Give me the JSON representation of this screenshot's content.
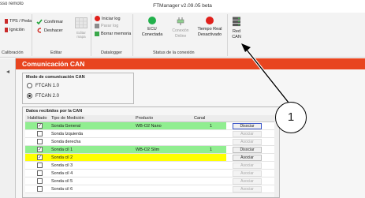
{
  "window": {
    "title": "FTManager v2.09.05 beta",
    "app_label": "sso remoto"
  },
  "ribbon": {
    "group1": {
      "items": [
        "TPS / Pedal",
        "Ignición"
      ],
      "label": "Calibración"
    },
    "group2": {
      "confirm": "Confirmar",
      "undo": "Deshacer",
      "edit_map": "Editar\nmapa",
      "label": "Editar"
    },
    "group3": {
      "items": [
        "Iniciar log",
        "Parar log",
        "Borrar memoria"
      ],
      "label": "Datalogger"
    },
    "group4": {
      "buttons": [
        {
          "label": "ECU\nConectada",
          "color": "#22b14c"
        },
        {
          "label": "Conexión\nOnline",
          "color": "#9a9a9a"
        },
        {
          "label": "Tiempo Real\nDesactivado",
          "color": "#e0201b"
        }
      ],
      "label": "Status de la conexión"
    },
    "group5": {
      "label": "Red\nCAN"
    }
  },
  "panel": {
    "title": "Comunicación CAN",
    "mode": {
      "legend": "Modo de comunicación CAN",
      "options": [
        {
          "label": "FTCAN 1.0",
          "selected": false
        },
        {
          "label": "FTCAN 2.0",
          "selected": true
        }
      ]
    },
    "data": {
      "legend": "Datos recibidos por la CAN",
      "columns": [
        "Habilitado",
        "Tipo de Medición",
        "Producto",
        "Canal"
      ],
      "rows": [
        {
          "checked": true,
          "type": "Sonda General",
          "product": "WB-O2 Nano",
          "channel": "1",
          "action": "Disociar",
          "highlight": "#90ee90",
          "enabled": true
        },
        {
          "checked": false,
          "type": "Sonda Izquierda",
          "product": "",
          "channel": "",
          "action": "Asociar",
          "highlight": "",
          "enabled": false
        },
        {
          "checked": false,
          "type": "Sonda derecha",
          "product": "",
          "channel": "",
          "action": "Asociar",
          "highlight": "",
          "enabled": false
        },
        {
          "checked": true,
          "type": "Sonda cil 1",
          "product": "WB-O2 Slim",
          "channel": "1",
          "action": "Disociar",
          "highlight": "#90ee90",
          "enabled": true
        },
        {
          "checked": true,
          "type": "Sonda cil 2",
          "product": "",
          "channel": "",
          "action": "Asociar",
          "highlight": "#ffff00",
          "enabled": true
        },
        {
          "checked": false,
          "type": "Sonda cil 3",
          "product": "",
          "channel": "",
          "action": "Asociar",
          "highlight": "",
          "enabled": false
        },
        {
          "checked": false,
          "type": "Sonda cil 4",
          "product": "",
          "channel": "",
          "action": "Asociar",
          "highlight": "",
          "enabled": false
        },
        {
          "checked": false,
          "type": "Sonda cil 5",
          "product": "",
          "channel": "",
          "action": "Asociar",
          "highlight": "",
          "enabled": false
        },
        {
          "checked": false,
          "type": "Sonda cil 6",
          "product": "",
          "channel": "",
          "action": "Asociar",
          "highlight": "",
          "enabled": false
        }
      ]
    }
  },
  "callout": {
    "number": "1"
  },
  "colors": {
    "header": "#e8451f",
    "ok_green": "#22b14c",
    "error_red": "#e0201b"
  }
}
